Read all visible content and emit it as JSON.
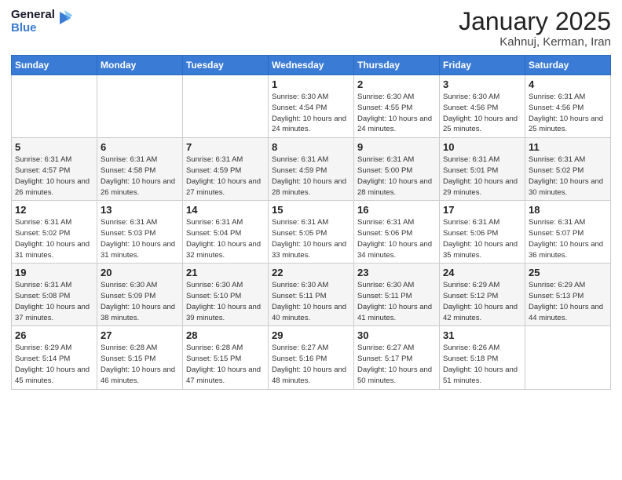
{
  "logo": {
    "general": "General",
    "blue": "Blue"
  },
  "header": {
    "month": "January 2025",
    "location": "Kahnuj, Kerman, Iran"
  },
  "days_of_week": [
    "Sunday",
    "Monday",
    "Tuesday",
    "Wednesday",
    "Thursday",
    "Friday",
    "Saturday"
  ],
  "weeks": [
    [
      {
        "day": "",
        "sunrise": "",
        "sunset": "",
        "daylight": ""
      },
      {
        "day": "",
        "sunrise": "",
        "sunset": "",
        "daylight": ""
      },
      {
        "day": "",
        "sunrise": "",
        "sunset": "",
        "daylight": ""
      },
      {
        "day": "1",
        "sunrise": "Sunrise: 6:30 AM",
        "sunset": "Sunset: 4:54 PM",
        "daylight": "Daylight: 10 hours and 24 minutes."
      },
      {
        "day": "2",
        "sunrise": "Sunrise: 6:30 AM",
        "sunset": "Sunset: 4:55 PM",
        "daylight": "Daylight: 10 hours and 24 minutes."
      },
      {
        "day": "3",
        "sunrise": "Sunrise: 6:30 AM",
        "sunset": "Sunset: 4:56 PM",
        "daylight": "Daylight: 10 hours and 25 minutes."
      },
      {
        "day": "4",
        "sunrise": "Sunrise: 6:31 AM",
        "sunset": "Sunset: 4:56 PM",
        "daylight": "Daylight: 10 hours and 25 minutes."
      }
    ],
    [
      {
        "day": "5",
        "sunrise": "Sunrise: 6:31 AM",
        "sunset": "Sunset: 4:57 PM",
        "daylight": "Daylight: 10 hours and 26 minutes."
      },
      {
        "day": "6",
        "sunrise": "Sunrise: 6:31 AM",
        "sunset": "Sunset: 4:58 PM",
        "daylight": "Daylight: 10 hours and 26 minutes."
      },
      {
        "day": "7",
        "sunrise": "Sunrise: 6:31 AM",
        "sunset": "Sunset: 4:59 PM",
        "daylight": "Daylight: 10 hours and 27 minutes."
      },
      {
        "day": "8",
        "sunrise": "Sunrise: 6:31 AM",
        "sunset": "Sunset: 4:59 PM",
        "daylight": "Daylight: 10 hours and 28 minutes."
      },
      {
        "day": "9",
        "sunrise": "Sunrise: 6:31 AM",
        "sunset": "Sunset: 5:00 PM",
        "daylight": "Daylight: 10 hours and 28 minutes."
      },
      {
        "day": "10",
        "sunrise": "Sunrise: 6:31 AM",
        "sunset": "Sunset: 5:01 PM",
        "daylight": "Daylight: 10 hours and 29 minutes."
      },
      {
        "day": "11",
        "sunrise": "Sunrise: 6:31 AM",
        "sunset": "Sunset: 5:02 PM",
        "daylight": "Daylight: 10 hours and 30 minutes."
      }
    ],
    [
      {
        "day": "12",
        "sunrise": "Sunrise: 6:31 AM",
        "sunset": "Sunset: 5:02 PM",
        "daylight": "Daylight: 10 hours and 31 minutes."
      },
      {
        "day": "13",
        "sunrise": "Sunrise: 6:31 AM",
        "sunset": "Sunset: 5:03 PM",
        "daylight": "Daylight: 10 hours and 31 minutes."
      },
      {
        "day": "14",
        "sunrise": "Sunrise: 6:31 AM",
        "sunset": "Sunset: 5:04 PM",
        "daylight": "Daylight: 10 hours and 32 minutes."
      },
      {
        "day": "15",
        "sunrise": "Sunrise: 6:31 AM",
        "sunset": "Sunset: 5:05 PM",
        "daylight": "Daylight: 10 hours and 33 minutes."
      },
      {
        "day": "16",
        "sunrise": "Sunrise: 6:31 AM",
        "sunset": "Sunset: 5:06 PM",
        "daylight": "Daylight: 10 hours and 34 minutes."
      },
      {
        "day": "17",
        "sunrise": "Sunrise: 6:31 AM",
        "sunset": "Sunset: 5:06 PM",
        "daylight": "Daylight: 10 hours and 35 minutes."
      },
      {
        "day": "18",
        "sunrise": "Sunrise: 6:31 AM",
        "sunset": "Sunset: 5:07 PM",
        "daylight": "Daylight: 10 hours and 36 minutes."
      }
    ],
    [
      {
        "day": "19",
        "sunrise": "Sunrise: 6:31 AM",
        "sunset": "Sunset: 5:08 PM",
        "daylight": "Daylight: 10 hours and 37 minutes."
      },
      {
        "day": "20",
        "sunrise": "Sunrise: 6:30 AM",
        "sunset": "Sunset: 5:09 PM",
        "daylight": "Daylight: 10 hours and 38 minutes."
      },
      {
        "day": "21",
        "sunrise": "Sunrise: 6:30 AM",
        "sunset": "Sunset: 5:10 PM",
        "daylight": "Daylight: 10 hours and 39 minutes."
      },
      {
        "day": "22",
        "sunrise": "Sunrise: 6:30 AM",
        "sunset": "Sunset: 5:11 PM",
        "daylight": "Daylight: 10 hours and 40 minutes."
      },
      {
        "day": "23",
        "sunrise": "Sunrise: 6:30 AM",
        "sunset": "Sunset: 5:11 PM",
        "daylight": "Daylight: 10 hours and 41 minutes."
      },
      {
        "day": "24",
        "sunrise": "Sunrise: 6:29 AM",
        "sunset": "Sunset: 5:12 PM",
        "daylight": "Daylight: 10 hours and 42 minutes."
      },
      {
        "day": "25",
        "sunrise": "Sunrise: 6:29 AM",
        "sunset": "Sunset: 5:13 PM",
        "daylight": "Daylight: 10 hours and 44 minutes."
      }
    ],
    [
      {
        "day": "26",
        "sunrise": "Sunrise: 6:29 AM",
        "sunset": "Sunset: 5:14 PM",
        "daylight": "Daylight: 10 hours and 45 minutes."
      },
      {
        "day": "27",
        "sunrise": "Sunrise: 6:28 AM",
        "sunset": "Sunset: 5:15 PM",
        "daylight": "Daylight: 10 hours and 46 minutes."
      },
      {
        "day": "28",
        "sunrise": "Sunrise: 6:28 AM",
        "sunset": "Sunset: 5:15 PM",
        "daylight": "Daylight: 10 hours and 47 minutes."
      },
      {
        "day": "29",
        "sunrise": "Sunrise: 6:27 AM",
        "sunset": "Sunset: 5:16 PM",
        "daylight": "Daylight: 10 hours and 48 minutes."
      },
      {
        "day": "30",
        "sunrise": "Sunrise: 6:27 AM",
        "sunset": "Sunset: 5:17 PM",
        "daylight": "Daylight: 10 hours and 50 minutes."
      },
      {
        "day": "31",
        "sunrise": "Sunrise: 6:26 AM",
        "sunset": "Sunset: 5:18 PM",
        "daylight": "Daylight: 10 hours and 51 minutes."
      },
      {
        "day": "",
        "sunrise": "",
        "sunset": "",
        "daylight": ""
      }
    ]
  ]
}
